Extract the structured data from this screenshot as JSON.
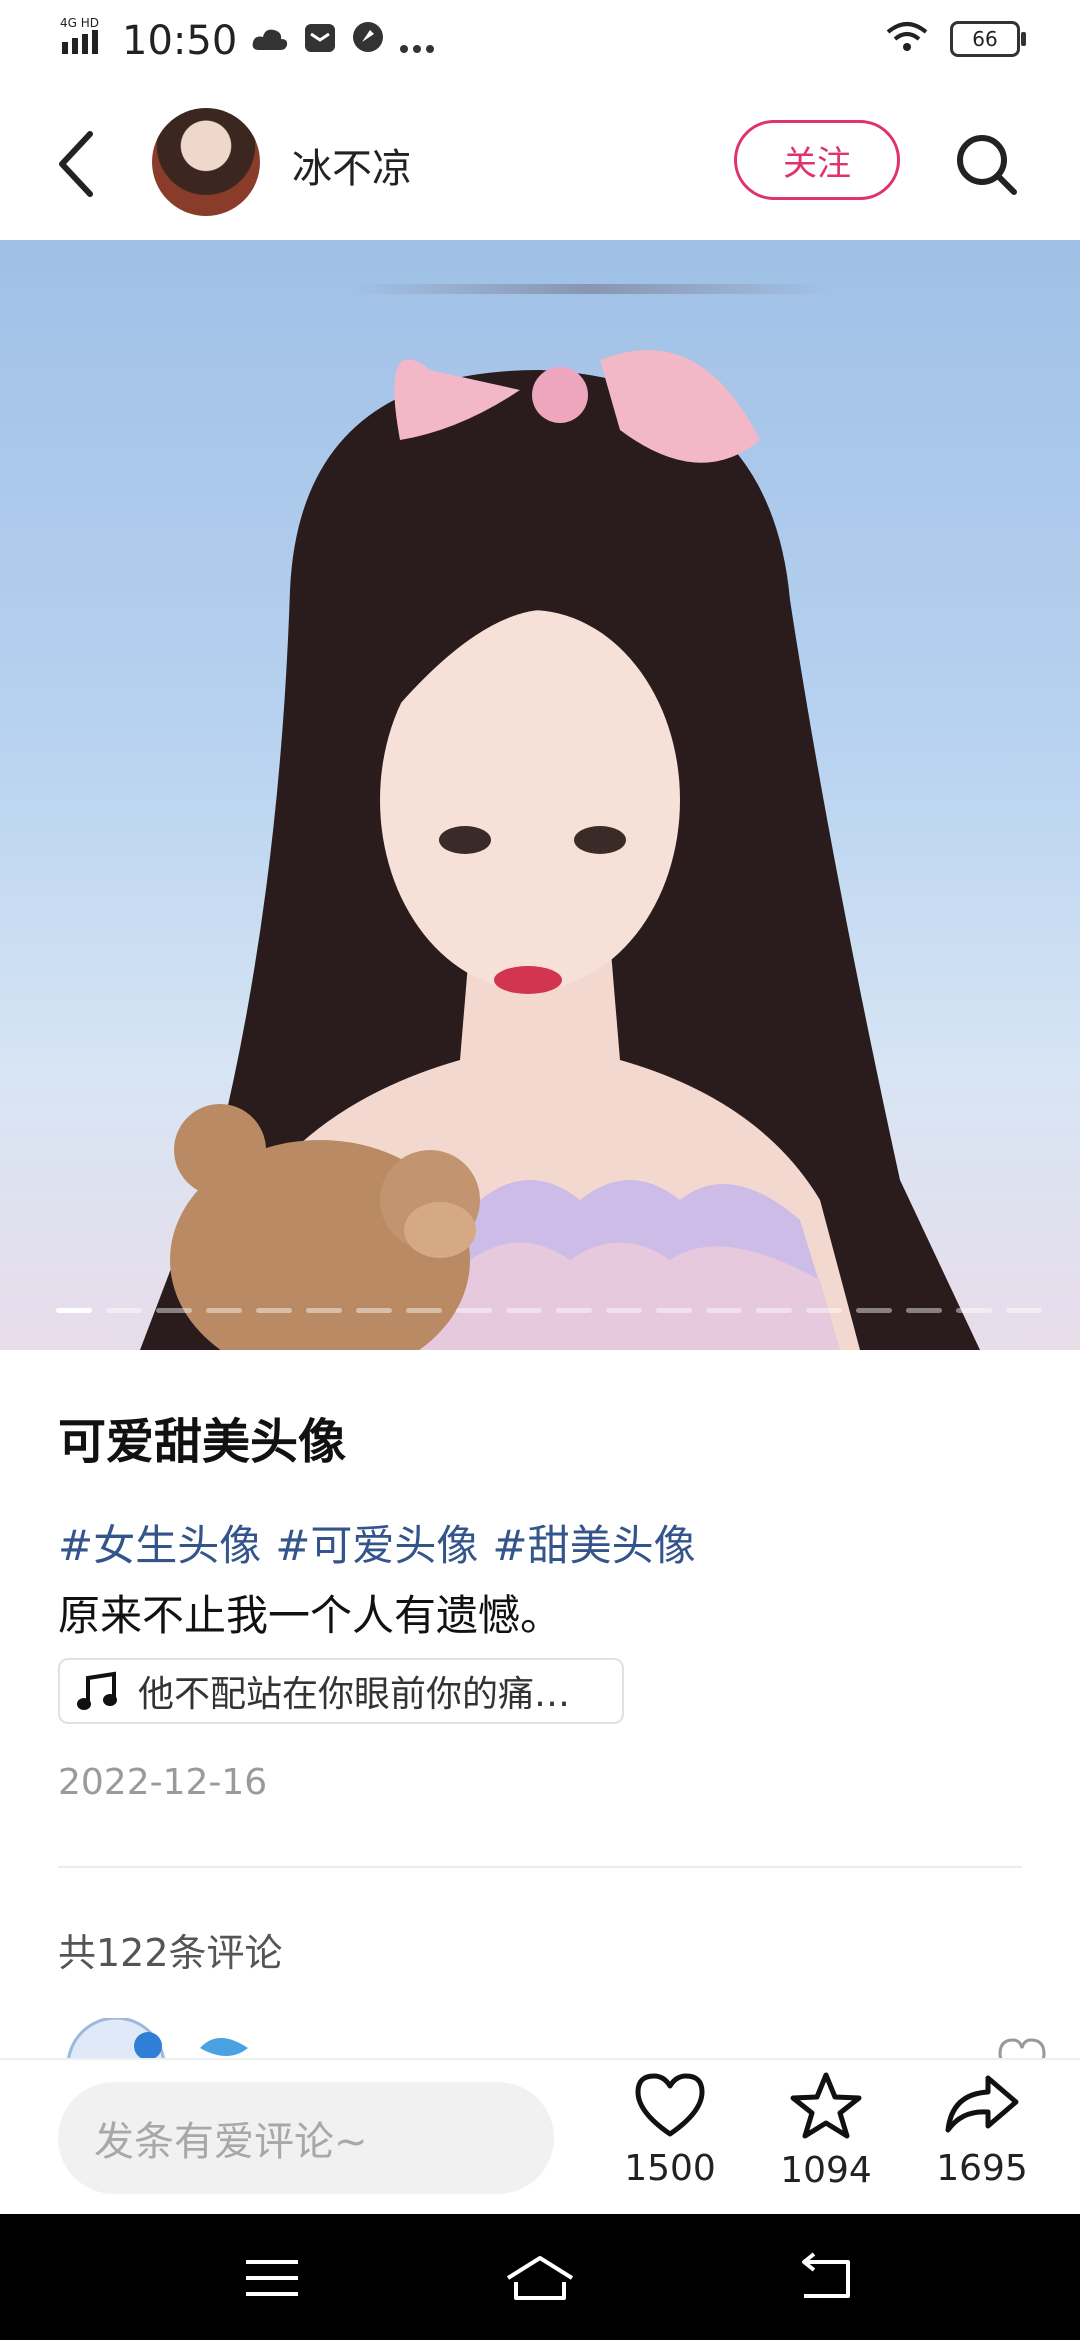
{
  "status": {
    "network": "4G HD",
    "time": "10:50",
    "battery": "66"
  },
  "header": {
    "username": "冰不凉",
    "follow_label": "关注"
  },
  "post": {
    "title": "可爱甜美头像",
    "tags": [
      "#女生头像",
      "#可爱头像",
      "#甜美头像"
    ],
    "description": " 原来不止我一个人有遗憾。",
    "music": "他不配站在你眼前你的痛…",
    "date": "2022-12-16",
    "comment_count": "共122条评论",
    "image_count": 20,
    "active_image": 1
  },
  "bottombar": {
    "placeholder": "发条有爱评论~",
    "likes": "1500",
    "favorites": "1094",
    "shares": "1695"
  },
  "colors": {
    "accent": "#e0336b",
    "tag": "#34558b"
  }
}
